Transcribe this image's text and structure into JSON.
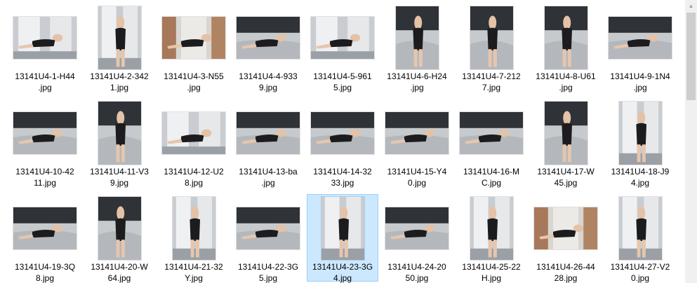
{
  "colors": {
    "selection_bg": "#cce8ff",
    "selection_border": "#99d1ff",
    "background": "#ffffff"
  },
  "icons": {
    "scroll_up": "chevron-up-icon"
  },
  "files": [
    {
      "line1": "13141U4-1-H44",
      "line2": ".jpg",
      "orientation": "landscape",
      "scene": "window"
    },
    {
      "line1": "13141U4-2-342",
      "line2": "1.jpg",
      "orientation": "portrait",
      "scene": "window"
    },
    {
      "line1": "13141U4-3-N55",
      "line2": ".jpg",
      "orientation": "landscape",
      "scene": "curtain"
    },
    {
      "line1": "13141U4-4-933",
      "line2": "9.jpg",
      "orientation": "landscape",
      "scene": "bed"
    },
    {
      "line1": "13141U4-5-961",
      "line2": "5.jpg",
      "orientation": "landscape",
      "scene": "window"
    },
    {
      "line1": "13141U4-6-H24",
      "line2": ".jpg",
      "orientation": "portrait",
      "scene": "bed"
    },
    {
      "line1": "13141U4-7-212",
      "line2": "7.jpg",
      "orientation": "portrait",
      "scene": "bed"
    },
    {
      "line1": "13141U4-8-U61",
      "line2": ".jpg",
      "orientation": "portrait",
      "scene": "bed"
    },
    {
      "line1": "13141U4-9-1N4",
      "line2": ".jpg",
      "orientation": "landscape",
      "scene": "bed"
    },
    {
      "line1": "13141U4-10-42",
      "line2": "11.jpg",
      "orientation": "landscape",
      "scene": "bed"
    },
    {
      "line1": "13141U4-11-V3",
      "line2": "9.jpg",
      "orientation": "portrait",
      "scene": "bed"
    },
    {
      "line1": "13141U4-12-U2",
      "line2": "8.jpg",
      "orientation": "landscape",
      "scene": "window"
    },
    {
      "line1": "13141U4-13-ba",
      "line2": ".jpg",
      "orientation": "landscape",
      "scene": "bed"
    },
    {
      "line1": "13141U4-14-32",
      "line2": "33.jpg",
      "orientation": "landscape",
      "scene": "bed"
    },
    {
      "line1": "13141U4-15-Y4",
      "line2": "0.jpg",
      "orientation": "landscape",
      "scene": "bed"
    },
    {
      "line1": "13141U4-16-M",
      "line2": "C.jpg",
      "orientation": "landscape",
      "scene": "bed"
    },
    {
      "line1": "13141U4-17-W",
      "line2": "45.jpg",
      "orientation": "portrait",
      "scene": "bed"
    },
    {
      "line1": "13141U4-18-J9",
      "line2": "4.jpg",
      "orientation": "portrait",
      "scene": "window"
    },
    {
      "line1": "13141U4-19-3Q",
      "line2": "8.jpg",
      "orientation": "landscape",
      "scene": "bed"
    },
    {
      "line1": "13141U4-20-W",
      "line2": "64.jpg",
      "orientation": "portrait",
      "scene": "bed"
    },
    {
      "line1": "13141U4-21-32",
      "line2": "Y.jpg",
      "orientation": "portrait",
      "scene": "window"
    },
    {
      "line1": "13141U4-22-3G",
      "line2": "5.jpg",
      "orientation": "landscape",
      "scene": "bed"
    },
    {
      "line1": "13141U4-23-3G",
      "line2": "4.jpg",
      "orientation": "portrait",
      "scene": "window",
      "selected": true
    },
    {
      "line1": "13141U4-24-20",
      "line2": "50.jpg",
      "orientation": "landscape",
      "scene": "bed"
    },
    {
      "line1": "13141U4-25-22",
      "line2": "H.jpg",
      "orientation": "portrait",
      "scene": "window"
    },
    {
      "line1": "13141U4-26-44",
      "line2": "28.jpg",
      "orientation": "landscape",
      "scene": "curtain"
    },
    {
      "line1": "13141U4-27-V2",
      "line2": "0.jpg",
      "orientation": "portrait",
      "scene": "window"
    }
  ]
}
